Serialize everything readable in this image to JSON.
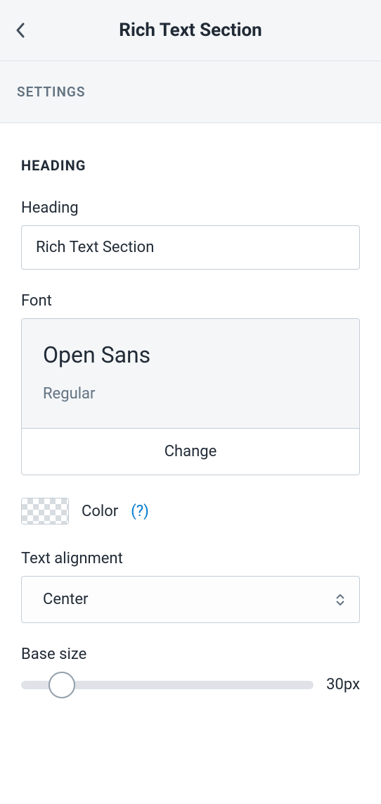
{
  "header": {
    "title": "Rich Text Section"
  },
  "settings": {
    "label": "SETTINGS"
  },
  "heading": {
    "section_label": "HEADING",
    "heading_label": "Heading",
    "heading_value": "Rich Text Section",
    "font_label": "Font",
    "font_name": "Open Sans",
    "font_weight": "Regular",
    "change_label": "Change",
    "color_label": "Color",
    "color_help": "(?)",
    "alignment_label": "Text alignment",
    "alignment_value": "Center",
    "base_size_label": "Base size",
    "base_size_value": "30px"
  }
}
